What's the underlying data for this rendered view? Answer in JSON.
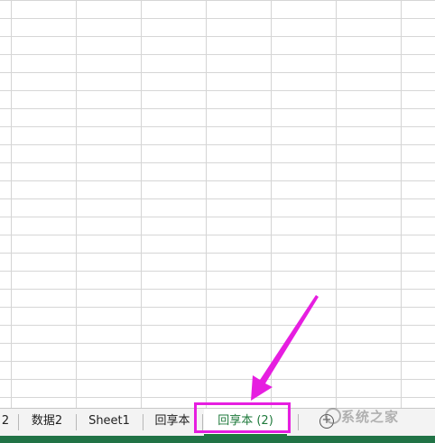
{
  "sheet_tabs": [
    {
      "label": "2"
    },
    {
      "label": "数据2"
    },
    {
      "label": "Sheet1"
    },
    {
      "label": "回享本"
    },
    {
      "label": "回享本 (2)"
    }
  ],
  "add_sheet_symbol": "+",
  "watermark_text": "系统之家",
  "colors": {
    "highlight": "#e61ee0",
    "arrow": "#e61ee0",
    "active_tab_text": "#1f7a3c",
    "statusbar": "#217346"
  }
}
